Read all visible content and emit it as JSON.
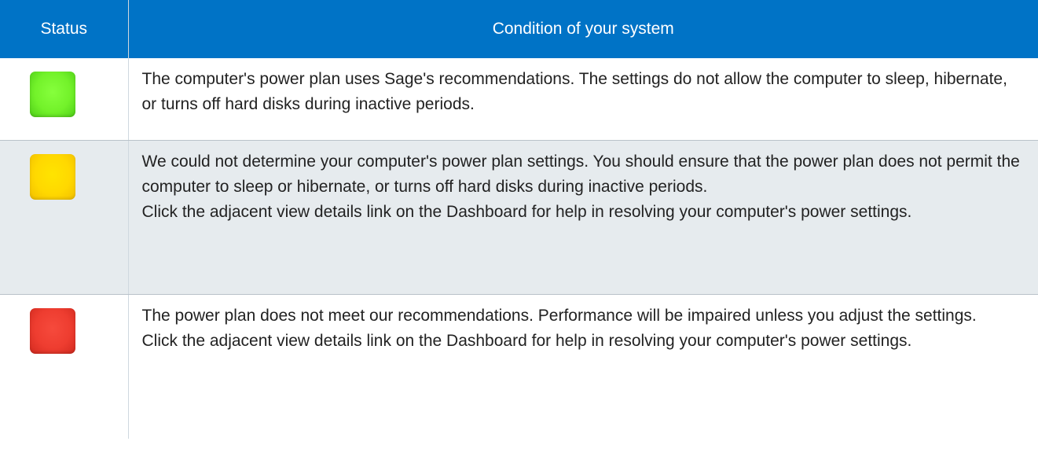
{
  "table": {
    "headers": {
      "status": "Status",
      "condition": "Condition of your system"
    },
    "header_color": "#0073c6",
    "rows": [
      {
        "status_color": "green",
        "status_hex": "#73f22a",
        "paragraphs": [
          "The computer's power plan uses Sage's recommendations. The settings do not allow the computer to sleep, hibernate, or turns off hard disks during inactive periods."
        ]
      },
      {
        "status_color": "yellow",
        "status_hex": "#ffd800",
        "paragraphs": [
          "We could not determine your computer's power plan settings. You should ensure that the power plan does not permit the computer to sleep or hibernate, or turns off hard disks during inactive periods.",
          "Click the adjacent view details link on the Dashboard for help in resolving your computer's power settings."
        ]
      },
      {
        "status_color": "red",
        "status_hex": "#ee3d30",
        "paragraphs": [
          "The power plan does not meet our recommendations. Performance will be impaired unless you adjust the settings.",
          "Click the adjacent view details link on the Dashboard for help in resolving your computer's power settings."
        ]
      }
    ]
  }
}
